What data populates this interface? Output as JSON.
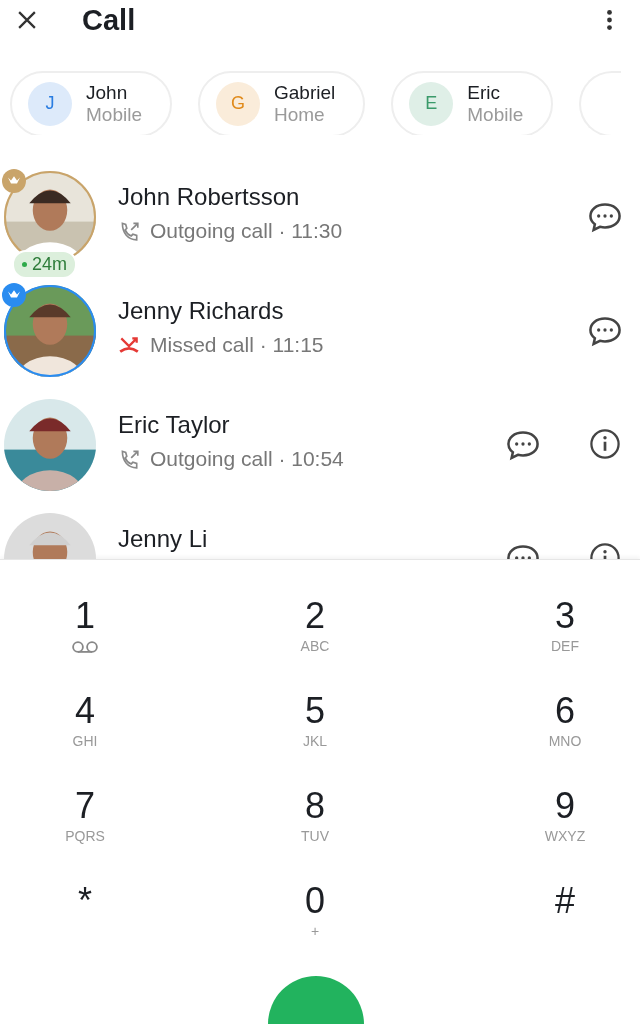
{
  "header": {
    "title": "Call"
  },
  "favorites": [
    {
      "letter": "J",
      "name": "John",
      "label": "Mobile",
      "color": "#2a7de1"
    },
    {
      "letter": "G",
      "name": "Gabriel",
      "label": "Home",
      "color": "#e08a1a"
    },
    {
      "letter": "E",
      "name": "Eric",
      "label": "Mobile",
      "color": "#3a9a6a"
    }
  ],
  "calls": [
    {
      "name": "John Robertsson",
      "missed": false,
      "detail": "Outgoing call · 11:30",
      "badge": {
        "color": "#c9a46a"
      },
      "duration": "24m",
      "actions": [
        {
          "kind": "message"
        }
      ],
      "picture": {
        "kind": "picture"
      }
    },
    {
      "name": "Jenny Richards",
      "missed": true,
      "detail": "Missed call · 11:15",
      "badge": {
        "color": "#2a8cf0"
      },
      "actions": [
        {
          "kind": "message"
        }
      ],
      "picture": {
        "kind": "picture"
      }
    },
    {
      "name": "Eric Taylor",
      "missed": false,
      "detail": "Outgoing call · 10:54",
      "actions": [
        {
          "kind": "message"
        },
        {
          "kind": "info"
        }
      ],
      "picture": {
        "kind": "picture"
      }
    },
    {
      "name": "Jenny Li",
      "actions": [
        {
          "kind": "message"
        },
        {
          "kind": "info"
        }
      ],
      "picture": {
        "kind": "picture"
      }
    }
  ],
  "dialpad": [
    {
      "digit": "1",
      "kind": "voicemail"
    },
    {
      "digit": "2",
      "letters": "ABC"
    },
    {
      "digit": "3",
      "letters": "DEF"
    },
    {
      "digit": "4",
      "letters": "GHI"
    },
    {
      "digit": "5",
      "letters": "JKL"
    },
    {
      "digit": "6",
      "letters": "MNO"
    },
    {
      "digit": "7",
      "letters": "PQRS"
    },
    {
      "digit": "8",
      "letters": "TUV"
    },
    {
      "digit": "9",
      "letters": "WXYZ"
    },
    {
      "digit": "*"
    },
    {
      "digit": "0",
      "letters": "+"
    },
    {
      "digit": "#"
    }
  ]
}
